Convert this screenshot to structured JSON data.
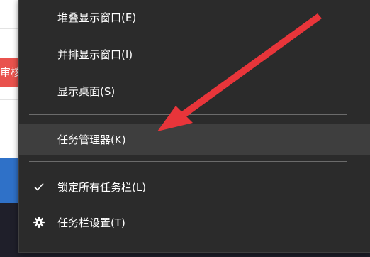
{
  "background": {
    "red_tag_text": "审核",
    "colors": {
      "red_tag": "#e9524d",
      "blue_band": "#2f71c8",
      "taskbar": "#1f1f2a"
    }
  },
  "context_menu": {
    "items": [
      {
        "label": "堆叠显示窗口(E)",
        "icon": "",
        "highlighted": false
      },
      {
        "label": "并排显示窗口(I)",
        "icon": "",
        "highlighted": false
      },
      {
        "label": "显示桌面(S)",
        "icon": "",
        "highlighted": false
      },
      {
        "label": "任务管理器(K)",
        "icon": "",
        "highlighted": true
      },
      {
        "label": "锁定所有任务栏(L)",
        "icon": "checkmark-icon",
        "highlighted": false
      },
      {
        "label": "任务栏设置(T)",
        "icon": "gear-icon",
        "highlighted": false
      }
    ],
    "colors": {
      "background": "#2b2b2b",
      "highlight": "#3e3e3e",
      "text": "#ffffff",
      "separator": "#6b6b6b"
    }
  },
  "annotation": {
    "arrow_color": "#e8353a",
    "points_to": "任务管理器(K)"
  }
}
